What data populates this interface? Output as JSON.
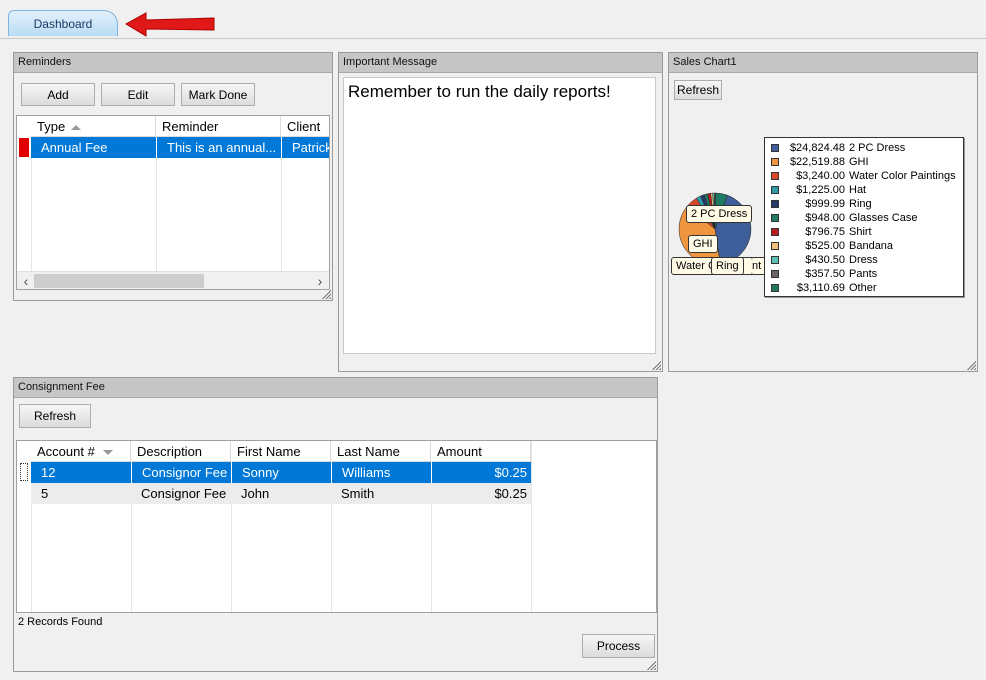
{
  "tabs": [
    {
      "label": "Dashboard"
    }
  ],
  "reminders": {
    "title": "Reminders",
    "buttons": {
      "add": "Add",
      "edit": "Edit",
      "mark_done": "Mark Done"
    },
    "columns": [
      "Type",
      "Reminder",
      "Client"
    ],
    "rows": [
      {
        "type": "Annual Fee",
        "reminder": "This is an annual...",
        "client": "Patrick"
      }
    ],
    "scroll_left": "‹",
    "scroll_right": "›"
  },
  "message": {
    "title": "Important Message",
    "text": "Remember to run the daily reports!"
  },
  "sales": {
    "title": "Sales Chart1",
    "refresh": "Refresh",
    "callouts": {
      "dress": "2 PC Dress",
      "ghi": "GHI",
      "water": "Water C",
      "ring": "Ring",
      "tail": "nt"
    }
  },
  "chart_data": {
    "type": "pie",
    "legend_position": "right",
    "slices": [
      {
        "value": "$24,824.48",
        "label": "2 PC Dress",
        "amount": 24824.48,
        "color": "#3f5f9b"
      },
      {
        "value": "$22,519.88",
        "label": "GHI",
        "amount": 22519.88,
        "color": "#f0953f"
      },
      {
        "value": "$3,240.00",
        "label": "Water Color Paintings",
        "amount": 3240.0,
        "color": "#d9482a"
      },
      {
        "value": "$1,225.00",
        "label": "Hat",
        "amount": 1225.0,
        "color": "#2f9aa8"
      },
      {
        "value": "$999.99",
        "label": "Ring",
        "amount": 999.99,
        "color": "#263a6b"
      },
      {
        "value": "$948.00",
        "label": "Glasses Case",
        "amount": 948.0,
        "color": "#1f7a64"
      },
      {
        "value": "$796.75",
        "label": "Shirt",
        "amount": 796.75,
        "color": "#b81e1e"
      },
      {
        "value": "$525.00",
        "label": "Bandana",
        "amount": 525.0,
        "color": "#f2c07a"
      },
      {
        "value": "$430.50",
        "label": "Dress",
        "amount": 430.5,
        "color": "#5bbfb3"
      },
      {
        "value": "$357.50",
        "label": "Pants",
        "amount": 357.5,
        "color": "#6e6464"
      },
      {
        "value": "$3,110.69",
        "label": "Other",
        "amount": 3110.69,
        "color": "#1f7a64"
      }
    ]
  },
  "consignment": {
    "title": "Consignment Fee",
    "refresh": "Refresh",
    "columns": [
      "Account #",
      "Description",
      "First Name",
      "Last Name",
      "Amount"
    ],
    "rows": [
      {
        "account": "12",
        "description": "Consignor Fee",
        "first": "Sonny",
        "last": "Williams",
        "amount": "$0.25"
      },
      {
        "account": "5",
        "description": "Consignor Fee",
        "first": "John",
        "last": "Smith",
        "amount": "$0.25"
      }
    ],
    "status": "2 Records Found",
    "process": "Process"
  },
  "colors": {
    "selection": "#0078d7",
    "reminder_flag": "#e00000",
    "arrow": "#e01818"
  }
}
